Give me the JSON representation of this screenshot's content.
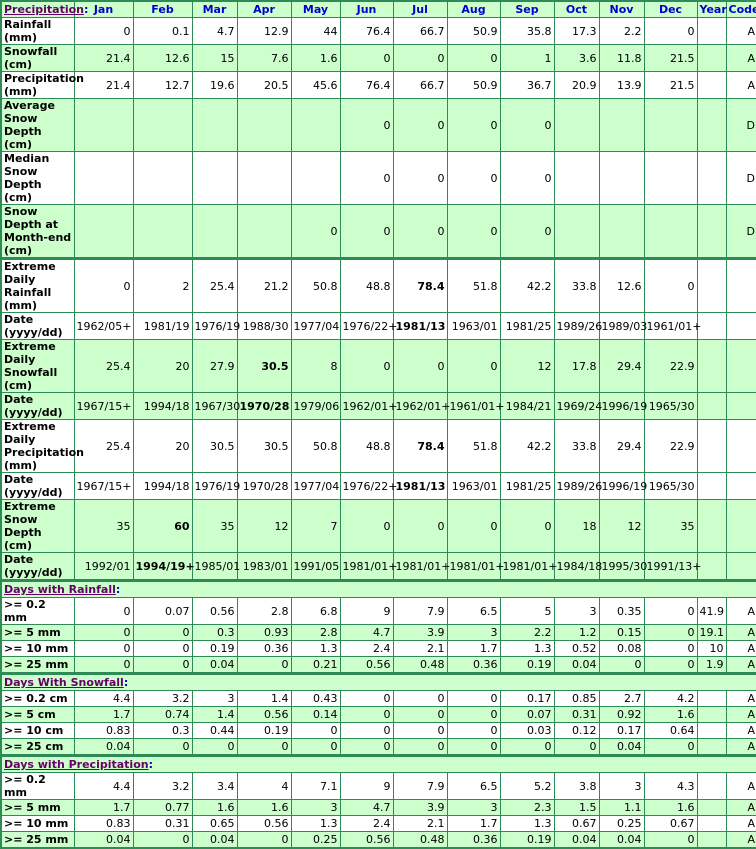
{
  "header": {
    "corner_label": "Precipitation",
    "colon": ":",
    "columns": [
      "Jan",
      "Feb",
      "Mar",
      "Apr",
      "May",
      "Jun",
      "Jul",
      "Aug",
      "Sep",
      "Oct",
      "Nov",
      "Dec",
      "Year",
      "Code"
    ]
  },
  "main_rows": [
    {
      "label": "Rainfall (mm)",
      "bg": "w",
      "values": [
        "0",
        "0.1",
        "4.7",
        "12.9",
        "44",
        "76.4",
        "66.7",
        "50.9",
        "35.8",
        "17.3",
        "2.2",
        "0",
        ""
      ],
      "code": "A"
    },
    {
      "label": "Snowfall (cm)",
      "bg": "g",
      "values": [
        "21.4",
        "12.6",
        "15",
        "7.6",
        "1.6",
        "0",
        "0",
        "0",
        "1",
        "3.6",
        "11.8",
        "21.5",
        ""
      ],
      "code": "A"
    },
    {
      "label": "Precipitation (mm)",
      "bg": "w",
      "values": [
        "21.4",
        "12.7",
        "19.6",
        "20.5",
        "45.6",
        "76.4",
        "66.7",
        "50.9",
        "36.7",
        "20.9",
        "13.9",
        "21.5",
        ""
      ],
      "code": "A"
    },
    {
      "label": "Average Snow Depth (cm)",
      "bg": "g",
      "values": [
        "",
        "",
        "",
        "",
        "",
        "0",
        "0",
        "0",
        "0",
        "",
        "",
        "",
        ""
      ],
      "code": "D"
    },
    {
      "label": "Median Snow Depth (cm)",
      "bg": "w",
      "values": [
        "",
        "",
        "",
        "",
        "",
        "0",
        "0",
        "0",
        "0",
        "",
        "",
        "",
        ""
      ],
      "code": "D"
    },
    {
      "label": "Snow Depth at Month-end (cm)",
      "bg": "g",
      "values": [
        "",
        "",
        "",
        "",
        "0",
        "0",
        "0",
        "0",
        "0",
        "",
        "",
        "",
        ""
      ],
      "code": "D"
    }
  ],
  "extreme_rows": [
    {
      "label": "Extreme Daily Rainfall (mm)",
      "bg": "w",
      "values": [
        "0",
        "2",
        "25.4",
        "21.2",
        "50.8",
        "48.8",
        "78.4",
        "51.8",
        "42.2",
        "33.8",
        "12.6",
        "0",
        ""
      ],
      "bold_index": 6,
      "code": ""
    },
    {
      "label": "Date (yyyy/dd)",
      "bg": "w",
      "values": [
        "1962/05+",
        "1981/19",
        "1976/19",
        "1988/30",
        "1977/04",
        "1976/22+",
        "1981/13",
        "1963/01",
        "1981/25",
        "1989/26",
        "1989/03",
        "1961/01+",
        ""
      ],
      "bold_index": 6,
      "code": ""
    },
    {
      "label": "Extreme Daily Snowfall (cm)",
      "bg": "g",
      "values": [
        "25.4",
        "20",
        "27.9",
        "30.5",
        "8",
        "0",
        "0",
        "0",
        "12",
        "17.8",
        "29.4",
        "22.9",
        ""
      ],
      "bold_index": 3,
      "code": ""
    },
    {
      "label": "Date (yyyy/dd)",
      "bg": "g",
      "values": [
        "1967/15+",
        "1994/18",
        "1967/30",
        "1970/28",
        "1979/06",
        "1962/01+",
        "1962/01+",
        "1961/01+",
        "1984/21",
        "1969/24",
        "1996/19",
        "1965/30",
        ""
      ],
      "bold_index": 3,
      "code": ""
    },
    {
      "label": "Extreme Daily Precipitation (mm)",
      "bg": "w",
      "values": [
        "25.4",
        "20",
        "30.5",
        "30.5",
        "50.8",
        "48.8",
        "78.4",
        "51.8",
        "42.2",
        "33.8",
        "29.4",
        "22.9",
        ""
      ],
      "bold_index": 6,
      "code": ""
    },
    {
      "label": "Date (yyyy/dd)",
      "bg": "w",
      "values": [
        "1967/15+",
        "1994/18",
        "1976/19",
        "1970/28",
        "1977/04",
        "1976/22+",
        "1981/13",
        "1963/01",
        "1981/25",
        "1989/26",
        "1996/19",
        "1965/30",
        ""
      ],
      "bold_index": 6,
      "code": ""
    },
    {
      "label": "Extreme Snow Depth (cm)",
      "bg": "g",
      "values": [
        "35",
        "60",
        "35",
        "12",
        "7",
        "0",
        "0",
        "0",
        "0",
        "18",
        "12",
        "35",
        ""
      ],
      "bold_index": 1,
      "code": ""
    },
    {
      "label": "Date (yyyy/dd)",
      "bg": "g",
      "values": [
        "1992/01",
        "1994/19+",
        "1985/01",
        "1983/01",
        "1991/05",
        "1981/01+",
        "1981/01+",
        "1981/01+",
        "1981/01+",
        "1984/18",
        "1995/30",
        "1991/13+",
        ""
      ],
      "bold_index": 1,
      "code": ""
    }
  ],
  "sections": [
    {
      "title": "Days with Rainfall",
      "rows": [
        {
          "label": ">= 0.2 mm",
          "bg": "w",
          "values": [
            "0",
            "0.07",
            "0.56",
            "2.8",
            "6.8",
            "9",
            "7.9",
            "6.5",
            "5",
            "3",
            "0.35",
            "0",
            "41.9"
          ],
          "code": "A"
        },
        {
          "label": ">= 5 mm",
          "bg": "g",
          "values": [
            "0",
            "0",
            "0.3",
            "0.93",
            "2.8",
            "4.7",
            "3.9",
            "3",
            "2.2",
            "1.2",
            "0.15",
            "0",
            "19.1"
          ],
          "code": "A"
        },
        {
          "label": ">= 10 mm",
          "bg": "w",
          "values": [
            "0",
            "0",
            "0.19",
            "0.36",
            "1.3",
            "2.4",
            "2.1",
            "1.7",
            "1.3",
            "0.52",
            "0.08",
            "0",
            "10"
          ],
          "code": "A"
        },
        {
          "label": ">= 25 mm",
          "bg": "g",
          "values": [
            "0",
            "0",
            "0.04",
            "0",
            "0.21",
            "0.56",
            "0.48",
            "0.36",
            "0.19",
            "0.04",
            "0",
            "0",
            "1.9"
          ],
          "code": "A"
        }
      ]
    },
    {
      "title": "Days With Snowfall",
      "rows": [
        {
          "label": ">= 0.2 cm",
          "bg": "w",
          "values": [
            "4.4",
            "3.2",
            "3",
            "1.4",
            "0.43",
            "0",
            "0",
            "0",
            "0.17",
            "0.85",
            "2.7",
            "4.2",
            ""
          ],
          "code": "A"
        },
        {
          "label": ">= 5 cm",
          "bg": "g",
          "values": [
            "1.7",
            "0.74",
            "1.4",
            "0.56",
            "0.14",
            "0",
            "0",
            "0",
            "0.07",
            "0.31",
            "0.92",
            "1.6",
            ""
          ],
          "code": "A"
        },
        {
          "label": ">= 10 cm",
          "bg": "w",
          "values": [
            "0.83",
            "0.3",
            "0.44",
            "0.19",
            "0",
            "0",
            "0",
            "0",
            "0.03",
            "0.12",
            "0.17",
            "0.64",
            ""
          ],
          "code": "A"
        },
        {
          "label": ">= 25 cm",
          "bg": "g",
          "values": [
            "0.04",
            "0",
            "0",
            "0",
            "0",
            "0",
            "0",
            "0",
            "0",
            "0",
            "0.04",
            "0",
            ""
          ],
          "code": "A"
        }
      ]
    },
    {
      "title": "Days with Precipitation",
      "rows": [
        {
          "label": ">= 0.2 mm",
          "bg": "w",
          "values": [
            "4.4",
            "3.2",
            "3.4",
            "4",
            "7.1",
            "9",
            "7.9",
            "6.5",
            "5.2",
            "3.8",
            "3",
            "4.3",
            ""
          ],
          "code": "A"
        },
        {
          "label": ">= 5 mm",
          "bg": "g",
          "values": [
            "1.7",
            "0.77",
            "1.6",
            "1.6",
            "3",
            "4.7",
            "3.9",
            "3",
            "2.3",
            "1.5",
            "1.1",
            "1.6",
            ""
          ],
          "code": "A"
        },
        {
          "label": ">= 10 mm",
          "bg": "w",
          "values": [
            "0.83",
            "0.31",
            "0.65",
            "0.56",
            "1.3",
            "2.4",
            "2.1",
            "1.7",
            "1.3",
            "0.67",
            "0.25",
            "0.67",
            ""
          ],
          "code": "A"
        },
        {
          "label": ">= 25 mm",
          "bg": "g",
          "values": [
            "0.04",
            "0",
            "0.04",
            "0",
            "0.25",
            "0.56",
            "0.48",
            "0.36",
            "0.19",
            "0.04",
            "0.04",
            "0",
            ""
          ],
          "code": "A"
        }
      ]
    }
  ],
  "colors": {
    "green_bg": "#ccffcc",
    "border": "#2e8b57",
    "label_blue": "#0000cc",
    "section_link": "#660066"
  }
}
